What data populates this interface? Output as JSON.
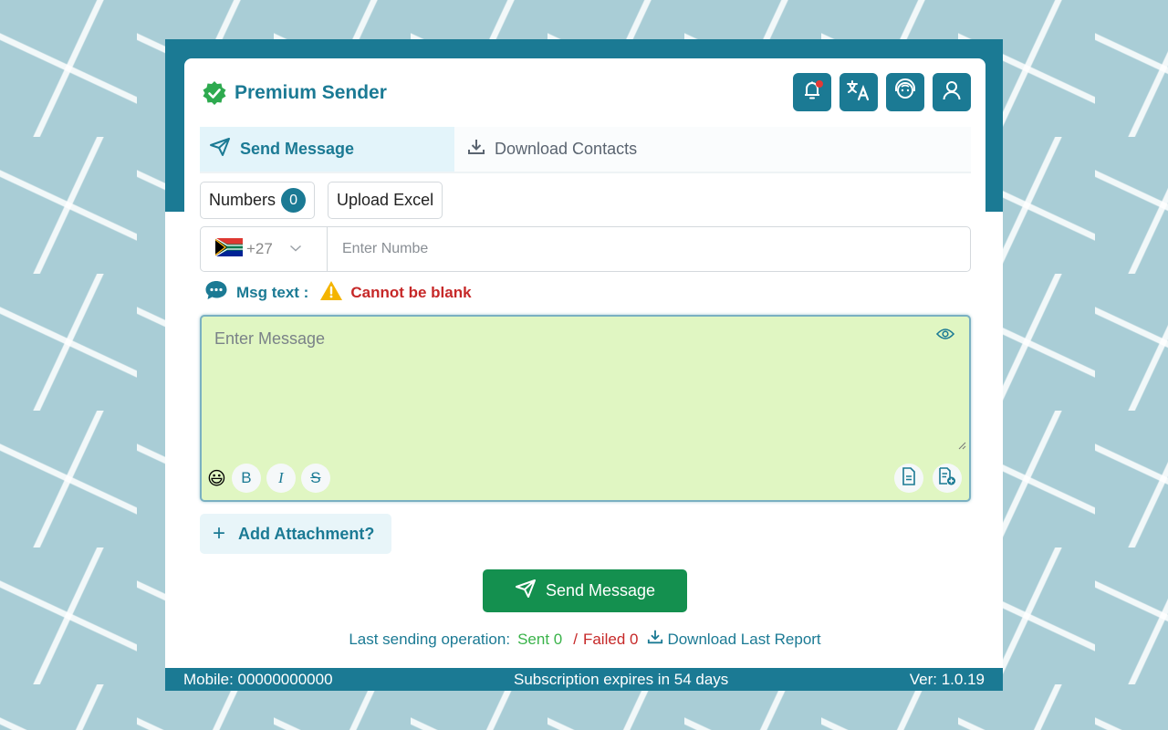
{
  "app": {
    "title": "Premium Sender",
    "brand_icon": "verified-badge-icon",
    "accent_color": "#1b7a94",
    "success_color": "#14904f",
    "error_color": "#c62828"
  },
  "header_buttons": [
    {
      "name": "notifications",
      "icon": "bell-icon"
    },
    {
      "name": "language",
      "icon": "translate-icon"
    },
    {
      "name": "support",
      "icon": "support-agent-icon"
    },
    {
      "name": "account",
      "icon": "user-icon"
    }
  ],
  "tabs": [
    {
      "label": "Send Message",
      "icon": "send-icon",
      "active": true
    },
    {
      "label": "Download Contacts",
      "icon": "download-icon",
      "active": false
    }
  ],
  "numbers": {
    "label": "Numbers",
    "count": "0",
    "upload_label": "Upload Excel"
  },
  "phone": {
    "country_code": "+27",
    "country_flag": "south-africa-flag-icon",
    "placeholder": "Enter Numbe",
    "value": ""
  },
  "message": {
    "label": "Msg text :",
    "error": "Cannot be blank",
    "placeholder": "Enter Message",
    "value": "",
    "emoji": "😃",
    "format_buttons": [
      "B",
      "I",
      "S"
    ]
  },
  "attachment": {
    "label": "Add Attachment?"
  },
  "send_button": {
    "label": "Send Message"
  },
  "last_operation": {
    "label": "Last sending operation:",
    "sent": "Sent 0",
    "separator": "/",
    "failed": "Failed 0",
    "download_label": "Download Last Report"
  },
  "footer": {
    "mobile": "Mobile: 00000000000",
    "subscription": "Subscription expires in 54 days",
    "version": "Ver: 1.0.19"
  }
}
